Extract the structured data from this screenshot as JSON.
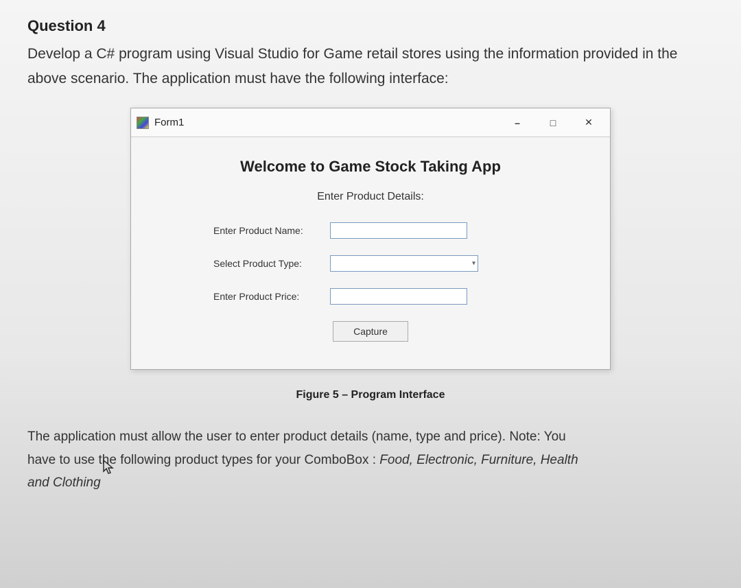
{
  "question": {
    "title": "Question 4",
    "text": "Develop a C# program using Visual Studio for Game retail stores using the information provided in the above scenario. The application must have the following interface:"
  },
  "window": {
    "title": "Form1",
    "controls": {
      "minimize": "–",
      "maximize": "□",
      "close": "✕"
    }
  },
  "app": {
    "heading": "Welcome to Game Stock Taking App",
    "subheading": "Enter Product Details:",
    "labels": {
      "name": "Enter Product Name:",
      "type": "Select Product Type:",
      "price": "Enter Product Price:"
    },
    "inputs": {
      "name_value": "",
      "type_value": "",
      "price_value": ""
    },
    "button": "Capture"
  },
  "figure_caption": "Figure 5 – Program Interface",
  "bottom": {
    "line1": "The application must allow the user to enter product details (name, type and price). Note: You",
    "line2_a": "have to use the following product types for your ComboBox : ",
    "line2_b": "Food, Electronic, Furniture, Health",
    "line3": "and Clothing"
  }
}
